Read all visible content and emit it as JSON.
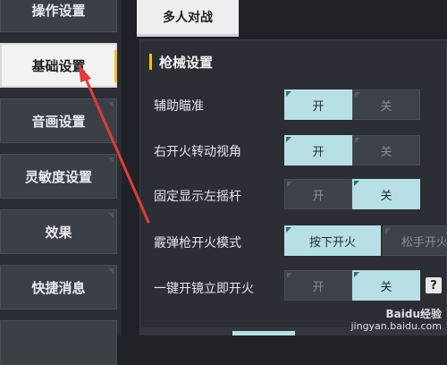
{
  "sidebar": {
    "items": [
      {
        "label": "操作设置"
      },
      {
        "label": "基础设置"
      },
      {
        "label": "音画设置"
      },
      {
        "label": "灵敏度设置"
      },
      {
        "label": "效果"
      },
      {
        "label": "快捷消息"
      }
    ],
    "active_index": 1
  },
  "top_tab": {
    "label": "多人对战"
  },
  "section": {
    "title": "枪械设置"
  },
  "rows": [
    {
      "label": "辅助瞄准",
      "options": [
        "开",
        "关"
      ],
      "selected": "开"
    },
    {
      "label": "右开火转动视角",
      "options": [
        "开",
        "关"
      ],
      "selected": "开"
    },
    {
      "label": "固定显示左摇杆",
      "options": [
        "开",
        "关"
      ],
      "selected": "关"
    },
    {
      "label": "霰弹枪开火模式",
      "options": [
        "按下开火",
        "松手开火"
      ],
      "selected": "按下开火"
    },
    {
      "label": "一键开镜立即开火",
      "options": [
        "开",
        "关"
      ],
      "selected": "关"
    }
  ],
  "help": {
    "icon": "question-icon",
    "glyph": "?"
  },
  "watermark": {
    "brand": "Baidu经验",
    "url": "jingyan.baidu.com"
  },
  "colors": {
    "accent": "#f1c40f",
    "toggle_on": "#b8dfe6",
    "arrow": "#e23b3b"
  }
}
